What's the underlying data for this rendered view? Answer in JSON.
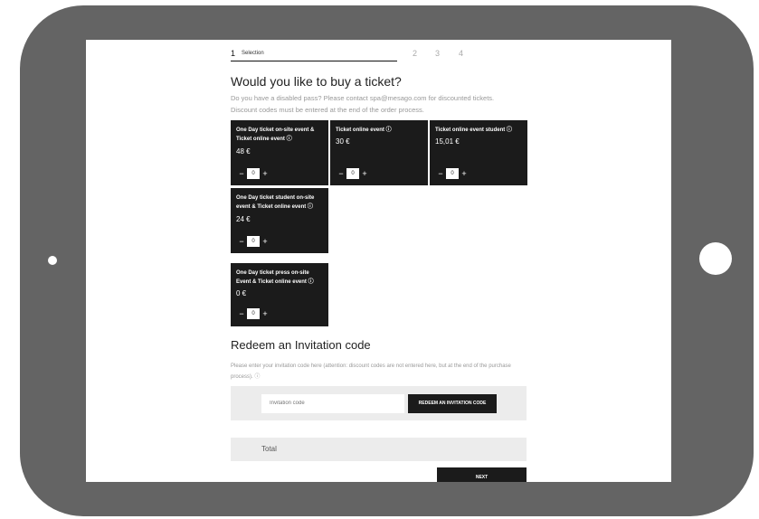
{
  "stepper": {
    "active_num": "1",
    "active_label": "Selection",
    "steps": [
      "2",
      "3",
      "4"
    ]
  },
  "heading": "Would you like to buy a ticket?",
  "info_line1": "Do you have a disabled pass? Please contact spa@mesago.com for discounted tickets.",
  "info_line2": "Discount codes must be entered at the end of the order process.",
  "info_icon": "info-circle-icon",
  "tickets": [
    {
      "name": "One Day ticket on-site event & Ticket online event ⓘ",
      "price": "48 €",
      "qty": "0",
      "minus": "−",
      "plus": "+"
    },
    {
      "name": "Ticket online event ⓘ",
      "price": "30 €",
      "qty": "0",
      "minus": "−",
      "plus": "+"
    },
    {
      "name": "Ticket online event student ⓘ",
      "price": "15,01 €",
      "qty": "0",
      "minus": "−",
      "plus": "+"
    },
    {
      "name": "One Day ticket student on-site event & Ticket online event ⓘ",
      "price": "24 €",
      "qty": "0",
      "minus": "−",
      "plus": "+"
    },
    {
      "name": "One Day ticket press on-site Event & Ticket online event ⓘ",
      "price": "0 €",
      "qty": "0",
      "minus": "−",
      "plus": "+"
    }
  ],
  "redeem": {
    "heading": "Redeem an Invitation code",
    "description": "Please enter your invitation code here (attention: discount codes are not entered here, but at the end of the purchase process). ⓘ",
    "placeholder": "Invitation code",
    "button": "REDEEM AN INVITATION CODE"
  },
  "total_label": "Total",
  "next_button": "NEXT",
  "colors": {
    "frame": "#646464",
    "card": "#1b1b1b",
    "panel": "#ececec"
  }
}
